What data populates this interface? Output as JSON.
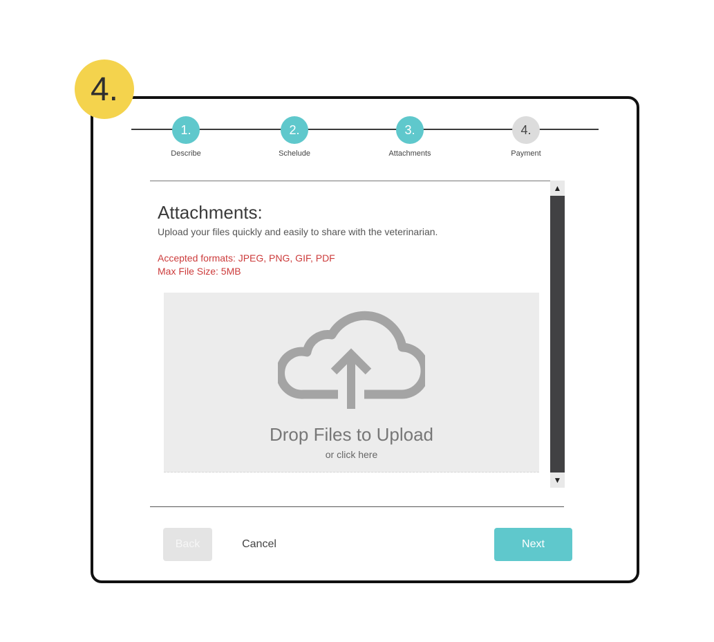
{
  "step_badge": "4.",
  "stepper": {
    "steps": [
      {
        "number": "1.",
        "label": "Describe",
        "state": "complete"
      },
      {
        "number": "2.",
        "label": "Schelude",
        "state": "complete"
      },
      {
        "number": "3.",
        "label": "Attachments",
        "state": "current"
      },
      {
        "number": "4.",
        "label": "Payment",
        "state": "pending"
      }
    ]
  },
  "content": {
    "title": "Attachments:",
    "description": "Upload your files quickly and easily to share with the veterinarian.",
    "formats": "Accepted formats: JPEG, PNG, GIF, PDF",
    "max_size": "Max File Size: 5MB"
  },
  "dropzone": {
    "icon": "cloud-upload-icon",
    "title": "Drop Files to Upload",
    "subtitle": "or click here"
  },
  "scrollbar": {
    "up_glyph": "▲",
    "down_glyph": "▼"
  },
  "actions": {
    "back_label": "Back",
    "cancel_label": "Cancel",
    "next_label": "Next"
  },
  "colors": {
    "accent": "#5fc8cc",
    "badge": "#f4d34d",
    "warning_text": "#cc3b3b",
    "inactive_step": "#dcdcdc"
  }
}
